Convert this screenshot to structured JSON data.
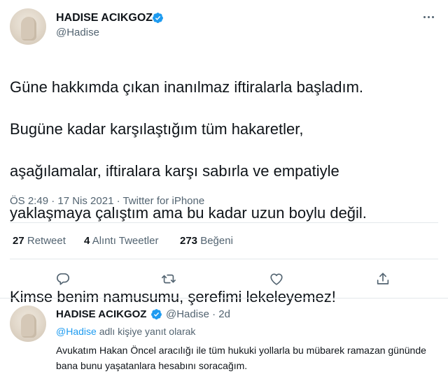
{
  "main_tweet": {
    "display_name": "HADISE ACIKGOZ",
    "handle": "@Hadise",
    "text": "Güne hakkımda çıkan inanılmaz iftiralarla başladım. Bugüne kadar karşılaştığım tüm hakaretler, aşağılamalar, iftiralara karşı sabırla ve empatiyle yaklaşmaya çalıştım ama bu kadar uzun boylu değil.\n\nKimse benim namusumu, şerefimi lekeleyemez!",
    "text_lines": [
      "Güne hakkımda çıkan inanılmaz iftiralarla başladım.",
      "Bugüne kadar karşılaştığım tüm hakaretler,",
      "aşağılamalar, iftiralara karşı sabırla ve empatiyle",
      "yaklaşmaya çalıştım ama bu kadar uzun boylu değil.",
      "",
      "Kimse benim namusumu, şerefimi lekeleyemez!"
    ],
    "meta": "ÖS 2:49 · 17 Nis 2021 · Twitter for iPhone",
    "stats": [
      {
        "count": "27",
        "label": "Retweet"
      },
      {
        "count": "4",
        "label": "Alıntı Tweetler"
      },
      {
        "count": "273",
        "label": "Beğeni"
      }
    ],
    "actions": [
      "reply-icon",
      "retweet-icon",
      "like-icon",
      "share-icon"
    ]
  },
  "reply_tweet": {
    "display_name": "HADISE ACIKGOZ",
    "handle_time": "@Hadise · 2d",
    "replying_mention": "@Hadise",
    "replying_suffix": "adlı kişiye yanıt olarak",
    "text": "Avukatım Hakan Öncel aracılığı ile tüm hukuki yollarla bu mübarek ramazan gününde bana bunu yaşatanlara hesabını soracağım."
  },
  "colors": {
    "text": "#0f1419",
    "secondary": "#536471",
    "accent": "#1d9bf0",
    "divider": "#e3e8eb"
  }
}
